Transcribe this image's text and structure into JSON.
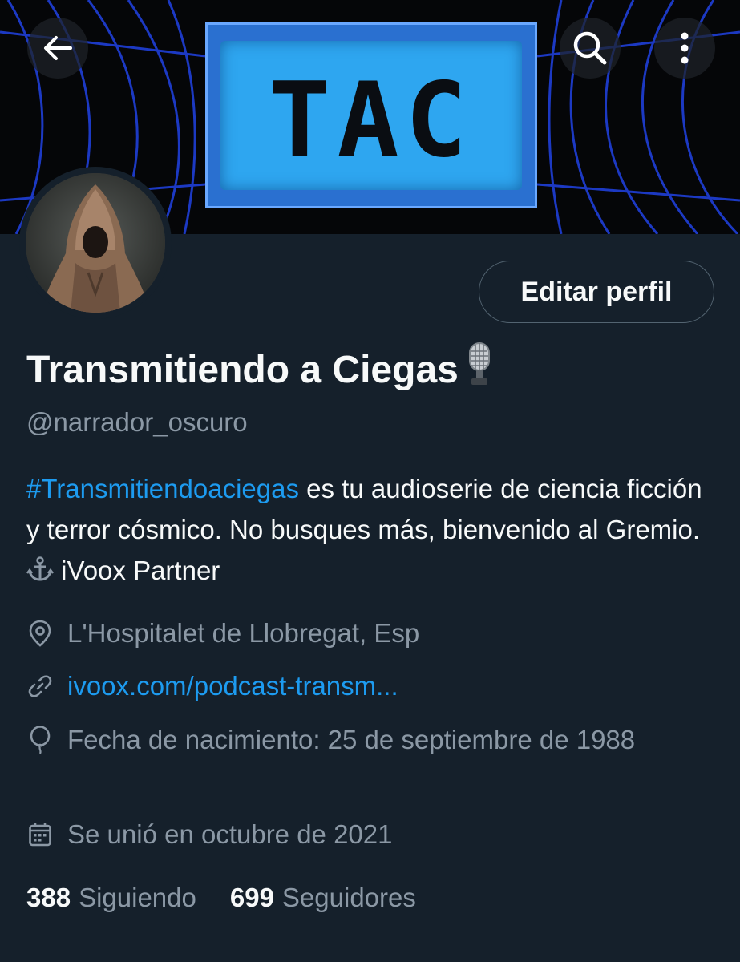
{
  "banner": {
    "logo_text": "TAC"
  },
  "topbar": {
    "back_icon": "arrow-left-icon",
    "search_icon": "search-icon",
    "more_icon": "more-vertical-icon"
  },
  "profile": {
    "edit_label": "Editar perfil",
    "name": "Transmitiendo a Ciegas",
    "name_emoji_icon": "microphone-icon",
    "handle": "@narrador_oscuro",
    "bio": {
      "hashtag": "#Transmitiendoaciegas",
      "text": " es tu audioserie de ciencia ficción y terror cósmico. No busques más, bienvenido al Gremio. ",
      "anchor_icon": "anchor-icon",
      "tail": " iVoox Partner"
    },
    "location": "L'Hospitalet de Llobregat, Esp",
    "link": "ivoox.com/podcast-transm...",
    "birth": "Fecha de nacimiento: 25 de septiembre de 1988",
    "joined": "Se unió en octubre de 2021"
  },
  "stats": {
    "following_count": "388",
    "following_label": "Siguiendo",
    "followers_count": "699",
    "followers_label": "Seguidores"
  },
  "colors": {
    "background": "#15202b",
    "accent": "#1d9bf0",
    "muted_text": "#8b98a5",
    "primary_text": "#f7f9f9"
  }
}
